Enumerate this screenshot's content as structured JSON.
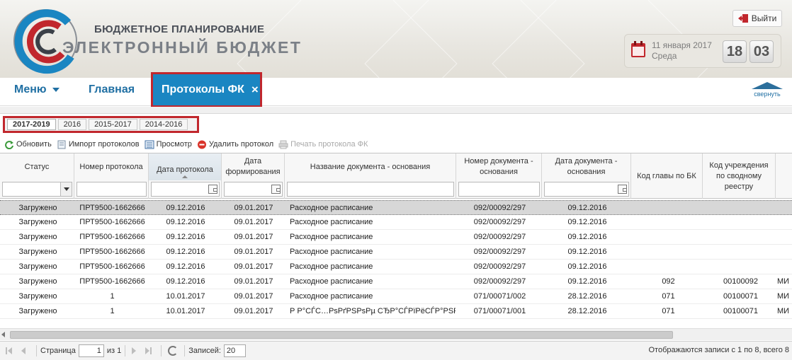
{
  "header": {
    "brand_top": "БЮДЖЕТНОЕ ПЛАНИРОВАНИЕ",
    "brand_main": "ЭЛЕКТРОННЫЙ БЮДЖЕТ",
    "logout_label": "Выйти",
    "date": "11 января 2017",
    "weekday": "Среда",
    "clock_hours": "18",
    "clock_minutes": "03"
  },
  "nav": {
    "menu_label": "Меню",
    "home_label": "Главная",
    "active_tab_label": "Протоколы ФК",
    "active_tab_close": "×",
    "collapse_label": "свернуть"
  },
  "year_tabs": [
    {
      "label": "2017-2019",
      "active": true
    },
    {
      "label": "2016",
      "active": false
    },
    {
      "label": "2015-2017",
      "active": false
    },
    {
      "label": "2014-2016",
      "active": false
    }
  ],
  "toolbar": {
    "refresh": "Обновить",
    "import": "Импорт протоколов",
    "view": "Просмотр",
    "delete": "Удалить протокол",
    "print": "Печать протокола ФК"
  },
  "grid": {
    "columns": [
      "Статус",
      "Номер протокола",
      "Дата протокола",
      "Дата формирования",
      "Название документа - основания",
      "Номер документа - основания",
      "Дата документа - основания",
      "Код главы по БК",
      "Код учреждения по сводному реестру",
      ""
    ],
    "rows": [
      [
        "Загружено",
        "ПРТ9500-1662666",
        "09.12.2016",
        "09.01.2017",
        "Расходное расписание",
        "092/00092/297",
        "09.12.2016",
        "",
        "",
        ""
      ],
      [
        "Загружено",
        "ПРТ9500-1662666",
        "09.12.2016",
        "09.01.2017",
        "Расходное расписание",
        "092/00092/297",
        "09.12.2016",
        "",
        "",
        ""
      ],
      [
        "Загружено",
        "ПРТ9500-1662666",
        "09.12.2016",
        "09.01.2017",
        "Расходное расписание",
        "092/00092/297",
        "09.12.2016",
        "",
        "",
        ""
      ],
      [
        "Загружено",
        "ПРТ9500-1662666",
        "09.12.2016",
        "09.01.2017",
        "Расходное расписание",
        "092/00092/297",
        "09.12.2016",
        "",
        "",
        ""
      ],
      [
        "Загружено",
        "ПРТ9500-1662666",
        "09.12.2016",
        "09.01.2017",
        "Расходное расписание",
        "092/00092/297",
        "09.12.2016",
        "",
        "",
        ""
      ],
      [
        "Загружено",
        "ПРТ9500-1662666",
        "09.12.2016",
        "09.01.2017",
        "Расходное расписание",
        "092/00092/297",
        "09.12.2016",
        "092",
        "00100092",
        "МИ"
      ],
      [
        "Загружено",
        "1",
        "10.01.2017",
        "09.01.2017",
        "Расходное расписание",
        "071/00071/002",
        "28.12.2016",
        "071",
        "00100071",
        "МИ"
      ],
      [
        "Загружено",
        "1",
        "10.01.2017",
        "09.01.2017",
        "Р Р°СЃС…РѕРґРЅРѕРµ СЂР°СЃРїРёСЃР°РЅРёРµ",
        "071/00071/001",
        "28.12.2016",
        "071",
        "00100071",
        "МИ"
      ]
    ],
    "selected_row": 0,
    "sorted_column": 2
  },
  "pager": {
    "page_label": "Страница",
    "page_value": "1",
    "of_label": "из 1",
    "records_label": "Записей:",
    "records_value": "20",
    "info": "Отображаются записи с 1 по 8, всего 8"
  },
  "colors": {
    "accent_blue": "#1a86c2",
    "nav_text": "#1f6fa3",
    "highlight_red": "#c1272d"
  }
}
